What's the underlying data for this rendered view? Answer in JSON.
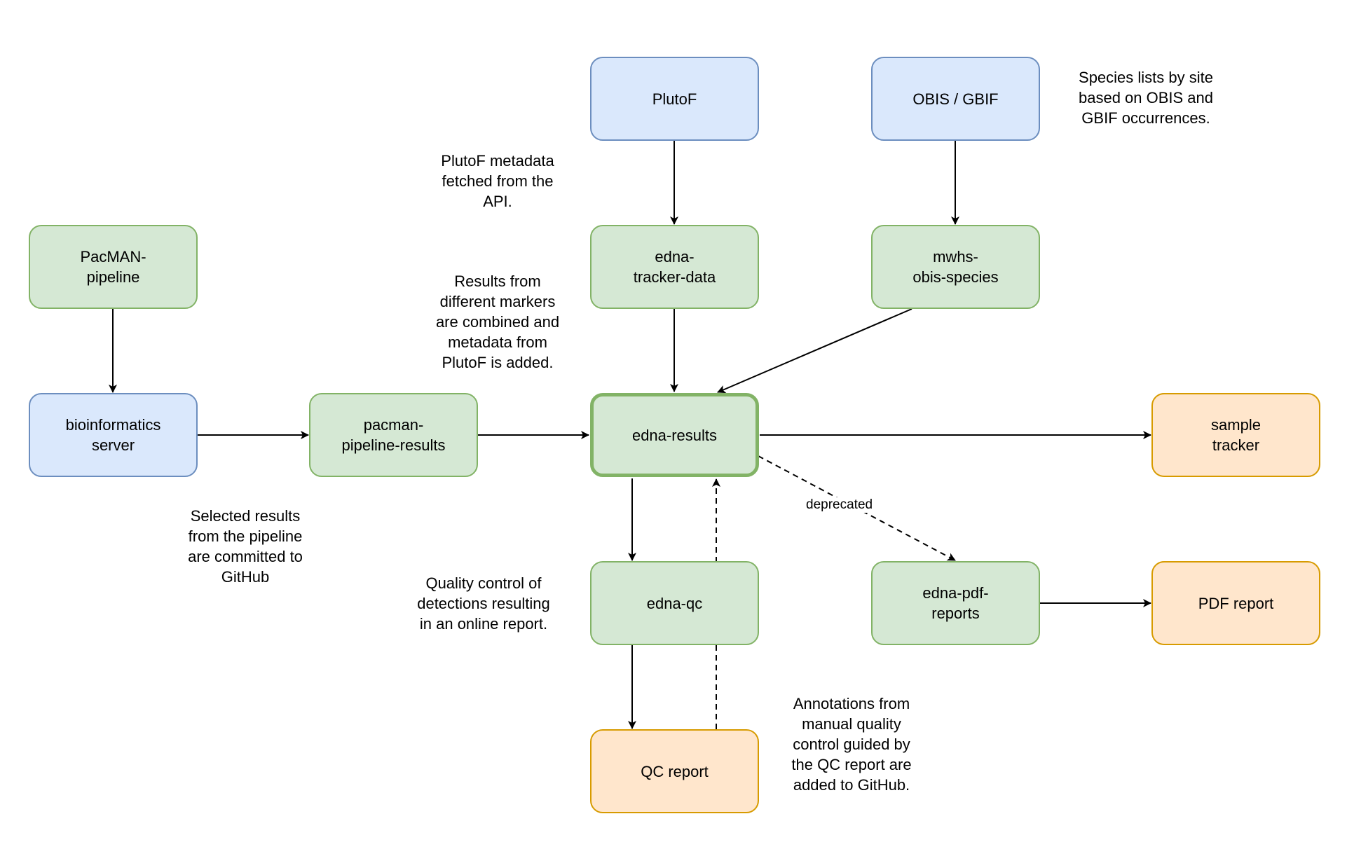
{
  "nodes": {
    "plutof": {
      "label": "PlutoF",
      "category": "external-source"
    },
    "obis_gbif": {
      "label": "OBIS / GBIF",
      "category": "external-source"
    },
    "pacman_pipeline": {
      "label": "PacMAN-\npipeline",
      "category": "repository"
    },
    "edna_tracker_data": {
      "label": "edna-\ntracker-data",
      "category": "repository"
    },
    "mwhs_obis_species": {
      "label": "mwhs-\nobis-species",
      "category": "repository"
    },
    "bioinformatics_server": {
      "label": "bioinformatics\nserver",
      "category": "external-source"
    },
    "pacman_pipeline_results": {
      "label": "pacman-\npipeline-results",
      "category": "repository"
    },
    "edna_results": {
      "label": "edna-results",
      "category": "repository-central"
    },
    "sample_tracker": {
      "label": "sample\ntracker",
      "category": "output"
    },
    "edna_qc": {
      "label": "edna-qc",
      "category": "repository"
    },
    "edna_pdf_reports": {
      "label": "edna-pdf-\nreports",
      "category": "repository"
    },
    "pdf_report": {
      "label": "PDF report",
      "category": "output"
    },
    "qc_report": {
      "label": "QC report",
      "category": "output"
    }
  },
  "edges": [
    {
      "from": "plutof",
      "to": "edna_tracker_data",
      "style": "solid"
    },
    {
      "from": "obis_gbif",
      "to": "mwhs_obis_species",
      "style": "solid"
    },
    {
      "from": "pacman_pipeline",
      "to": "bioinformatics_server",
      "style": "solid"
    },
    {
      "from": "edna_tracker_data",
      "to": "edna_results",
      "style": "solid"
    },
    {
      "from": "mwhs_obis_species",
      "to": "edna_results",
      "style": "solid"
    },
    {
      "from": "bioinformatics_server",
      "to": "pacman_pipeline_results",
      "style": "solid"
    },
    {
      "from": "pacman_pipeline_results",
      "to": "edna_results",
      "style": "solid"
    },
    {
      "from": "edna_results",
      "to": "sample_tracker",
      "style": "solid"
    },
    {
      "from": "edna_results",
      "to": "edna_qc",
      "style": "solid"
    },
    {
      "from": "edna_results",
      "to": "edna_pdf_reports",
      "style": "dashed",
      "label": "deprecated"
    },
    {
      "from": "edna_pdf_reports",
      "to": "pdf_report",
      "style": "solid"
    },
    {
      "from": "edna_qc",
      "to": "qc_report",
      "style": "solid"
    },
    {
      "from": "qc_report",
      "to": "edna_results",
      "style": "dashed"
    }
  ],
  "edge_labels": {
    "deprecated": "deprecated"
  },
  "notes": {
    "species_lists": "Species lists by site\nbased on OBIS and\nGBIF occurrences.",
    "plutof_metadata": "PlutoF metadata\nfetched from the\nAPI.",
    "results_combined": "Results from\ndifferent markers\nare combined and\nmetadata from\nPlutoF is added.",
    "selected_results": "Selected results\nfrom the pipeline\nare committed to\nGitHub",
    "quality_control": "Quality control of\ndetections resulting\nin an online report.",
    "annotations": "Annotations from\nmanual quality\ncontrol guided by\nthe QC report are\nadded to GitHub."
  },
  "colors": {
    "green_fill": "#d5e8d4",
    "green_stroke": "#82b366",
    "blue_fill": "#dae8fc",
    "blue_stroke": "#6c8ebf",
    "orange_fill": "#ffe6cc",
    "orange_stroke": "#d79b00",
    "edge": "#000000"
  }
}
